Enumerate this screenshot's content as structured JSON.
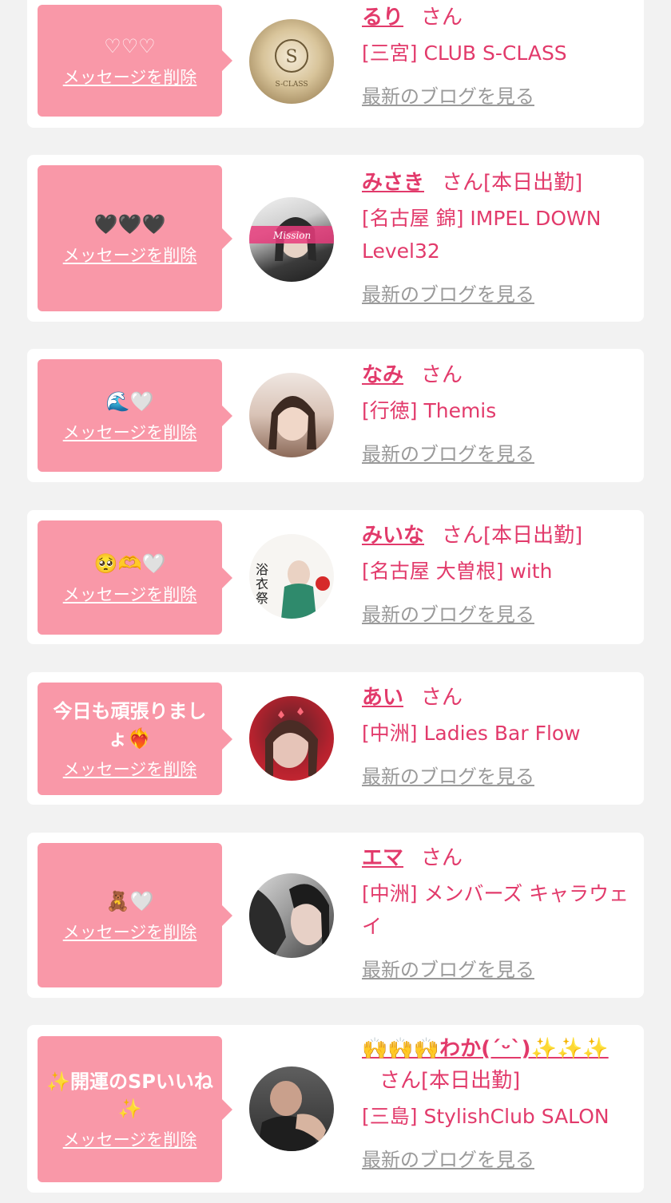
{
  "delete_label": "メッセージを削除",
  "honorific": "さん",
  "blog_label": "最新のブログを見る",
  "entries": [
    {
      "message": "♡♡♡",
      "name": "るり",
      "today": "",
      "shop": "[三宮] CLUB S-CLASS"
    },
    {
      "message": "🖤🖤🖤",
      "name": "みさき",
      "today": "[本日出勤]",
      "shop": "[名古屋 錦] IMPEL DOWN Level32"
    },
    {
      "message": "🌊🤍",
      "name": "なみ",
      "today": "",
      "shop": "[行徳] Themis"
    },
    {
      "message": "🥺🫶🤍",
      "name": "みいな",
      "today": "[本日出勤]",
      "shop": "[名古屋 大曽根] with"
    },
    {
      "message": "今日も頑張りましょ❤️‍🔥",
      "name": "あい",
      "today": "",
      "shop": "[中洲] Ladies Bar Flow"
    },
    {
      "message": "🧸🤍",
      "name": "エマ",
      "today": "",
      "shop": "[中洲] メンバーズ キャラウェイ"
    },
    {
      "message": "✨開運のSPいいね✨",
      "name": "🙌🙌🙌わか(ˊᵕˋ)✨✨✨",
      "today": "[本日出勤]",
      "shop": "[三島] StylishClub SALON"
    }
  ]
}
